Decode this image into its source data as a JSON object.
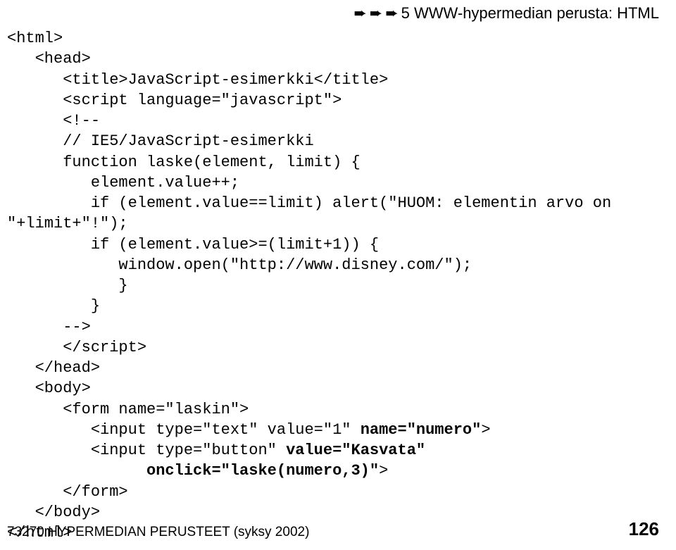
{
  "header": {
    "arrow": "➨",
    "arrow_count": 3,
    "text": "5 WWW-hypermedian perusta: HTML"
  },
  "code": {
    "line01": "<html>",
    "line02": "   <head>",
    "line03": "      <title>JavaScript-esimerkki</title>",
    "line04": "      <script language=\"javascript\">",
    "line05": "      <!--",
    "line06": "      // IE5/JavaScript-esimerkki",
    "line07": "      function laske(element, limit) {",
    "line08": "         element.value++;",
    "line09": "         if (element.value==limit) alert(\"HUOM: elementin arvo on",
    "line10": "\"+limit+\"!\");",
    "line11": "         if (element.value>=(limit+1)) {",
    "line12": "            window.open(\"http://www.disney.com/\");",
    "line13": "            }",
    "line14": "         }",
    "line15": "      -->",
    "line16_close_script": "      </script>",
    "line17": "   </head>",
    "line18": "   <body>",
    "line19": "      <form name=\"laskin\">",
    "line20": "         <input type=\"text\" value=\"1\" ",
    "line20b": "name=\"numero\"",
    "line20c": ">",
    "line21": "         <input type=\"button\" ",
    "line21b": "value=\"Kasvata\"",
    "line22": "               onclick=\"laske(numero,3)\"",
    "line22b": ">",
    "line23": "      </form>",
    "line24": "   </body>",
    "line25": "</html>"
  },
  "footer": {
    "left": "73270 HYPERMEDIAN PERUSTEET (syksy 2002)",
    "page": "126"
  }
}
